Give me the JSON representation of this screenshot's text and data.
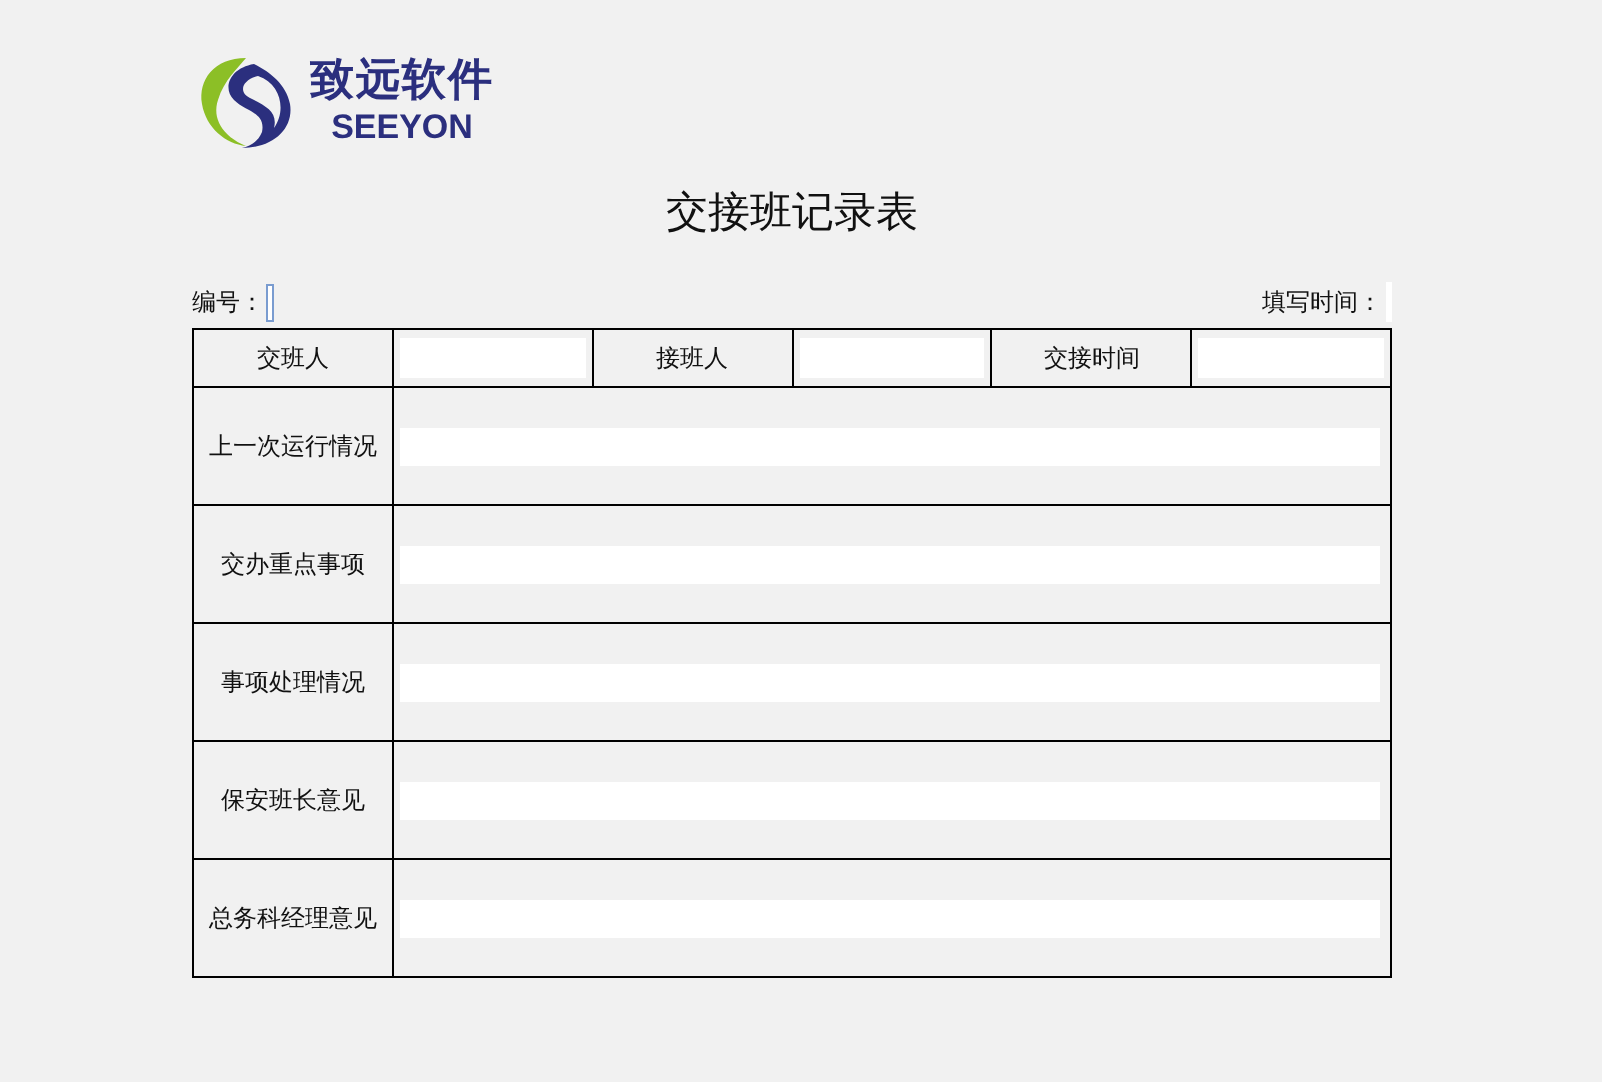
{
  "logo": {
    "name": "致远软件",
    "wordmark": "SEEYON"
  },
  "title": "交接班记录表",
  "meta": {
    "number_label": "编号：",
    "time_label": "填写时间："
  },
  "header": [
    {
      "label": "交班人"
    },
    {
      "label": "接班人"
    },
    {
      "label": "交接时间"
    }
  ],
  "rows": [
    {
      "label": "上一次运行情况"
    },
    {
      "label": "交办重点事项"
    },
    {
      "label": "事项处理情况"
    },
    {
      "label": "保安班长意见"
    },
    {
      "label": "总务科经理意见"
    }
  ]
}
